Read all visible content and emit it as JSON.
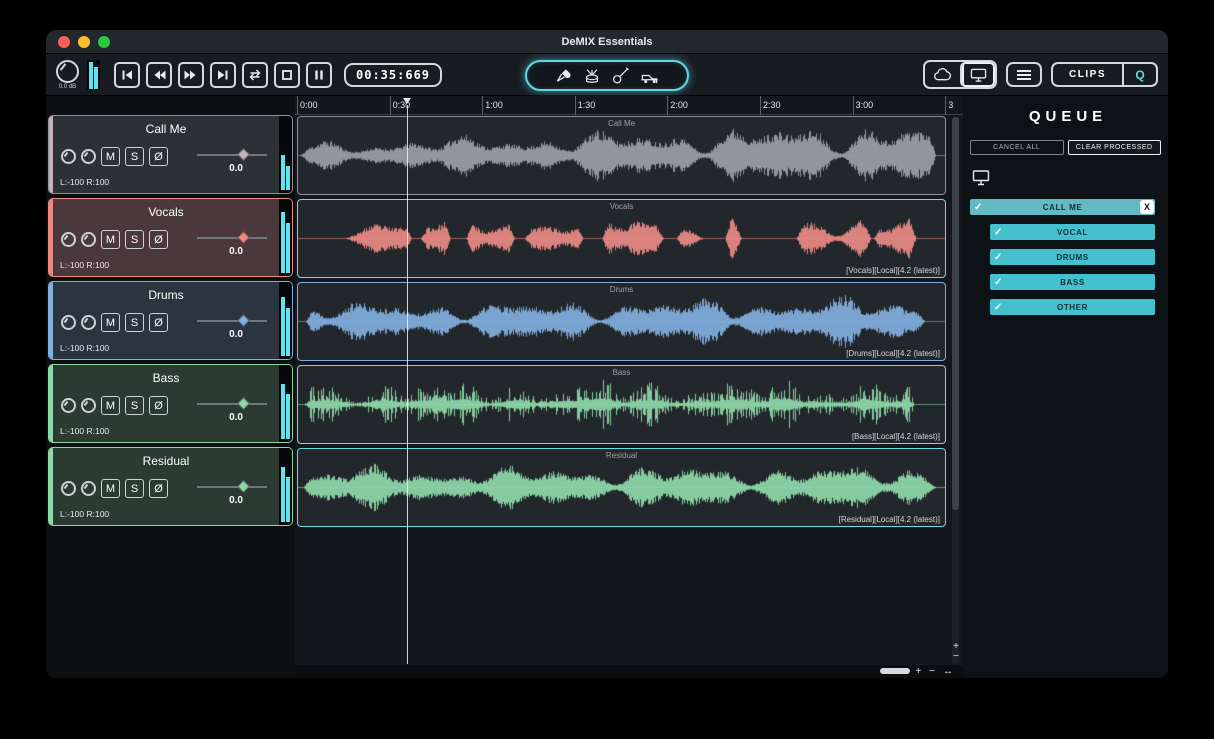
{
  "window": {
    "title": "DeMIX Essentials"
  },
  "toolbar": {
    "gain_label": "0.0 dB",
    "time_display": "00:35:669",
    "clips_label": "CLIPS",
    "queue_toggle_label": "Q"
  },
  "controls": {
    "mute": "M",
    "solo": "S",
    "phase": "Ø"
  },
  "timeline": {
    "ticks": [
      "0:00",
      "0:30",
      "1:00",
      "1:30",
      "2:00",
      "2:30",
      "3:00",
      "3"
    ]
  },
  "vzoom": {
    "zoom_in": "+",
    "zoom_out": "−"
  },
  "hscroll": {
    "zoom_in": "+",
    "zoom_out": "−",
    "fit": "↔"
  },
  "tracks": [
    {
      "name": "Call Me",
      "volume": "0.0",
      "pan": "L:-100 R:100",
      "color": "#c4b2b8",
      "header_bg": "#2c3136",
      "border": "#8b9196",
      "meters": [
        0.5,
        0.34
      ]
    },
    {
      "name": "Vocals",
      "volume": "0.0",
      "pan": "L:-100 R:100",
      "color": "#e98a84",
      "header_bg": "#4a383c",
      "border": "#e98a84",
      "meters": [
        0.88,
        0.72
      ]
    },
    {
      "name": "Drums",
      "volume": "0.0",
      "pan": "L:-100 R:100",
      "color": "#82aede",
      "header_bg": "#2b3540",
      "border": "#82aede",
      "meters": [
        0.85,
        0.7
      ]
    },
    {
      "name": "Bass",
      "volume": "0.0",
      "pan": "L:-100 R:100",
      "color": "#8fd9a9",
      "header_bg": "#2b3a33",
      "border": "#8fd9a9",
      "meters": [
        0.8,
        0.66
      ]
    },
    {
      "name": "Residual",
      "volume": "0.0",
      "pan": "L:-100 R:100",
      "color": "#8fd9a9",
      "header_bg": "#2b3a33",
      "border": "#8fd9a9",
      "meters": [
        0.8,
        0.66
      ]
    }
  ],
  "lanes": [
    {
      "label": "Call Me",
      "tag": "",
      "color": "#9aa0a3",
      "border": "#8b9196",
      "wave": {
        "seed": 11,
        "amp": 0.82,
        "ramp": [
          0.42,
          1.12
        ],
        "segments": [
          [
            0.004,
            0.985
          ]
        ]
      }
    },
    {
      "label": "Vocals",
      "tag": "[Vocals][Local][4.2 (latest)]",
      "color": "#e98a84",
      "border": "#6adbe6",
      "wave": {
        "seed": 23,
        "amp": 0.6,
        "ramp": [
          1,
          1
        ],
        "segments": [
          [
            0.075,
            0.175
          ],
          [
            0.19,
            0.235
          ],
          [
            0.26,
            0.335
          ],
          [
            0.35,
            0.44
          ],
          [
            0.47,
            0.565
          ],
          [
            0.585,
            0.625
          ],
          [
            0.66,
            0.685
          ],
          [
            0.77,
            0.885
          ],
          [
            0.89,
            0.955
          ]
        ]
      }
    },
    {
      "label": "Drums",
      "tag": "[Drums][Local][4.2 (latest)]",
      "color": "#82aede",
      "border": "#82aede",
      "wave": {
        "seed": 37,
        "amp": 0.62,
        "ramp": [
          0.75,
          1.05
        ],
        "segments": [
          [
            0.012,
            0.968
          ]
        ]
      }
    },
    {
      "label": "Bass",
      "tag": "[Bass][Local][4.2 (latest)]",
      "color": "#8fd9a9",
      "border": "#8fd9a9",
      "wave": {
        "seed": 51,
        "amp": 0.42,
        "spiky": true,
        "ramp": [
          1,
          1
        ],
        "segments": [
          [
            0.01,
            0.952
          ]
        ]
      }
    },
    {
      "label": "Residual",
      "tag": "[Residual][Local][4.2 (latest)]",
      "color": "#8fd9a9",
      "border": "#6adbe6",
      "wave": {
        "seed": 67,
        "amp": 0.55,
        "ramp": [
          0.95,
          1.05
        ],
        "segments": [
          [
            0.008,
            0.985
          ]
        ]
      }
    }
  ],
  "queue": {
    "title": "QUEUE",
    "cancel_all_label": "CANCEL ALL",
    "clear_processed_label": "CLEAR PROCESSED",
    "check_glyph": "✓",
    "close_label": "X",
    "items": [
      {
        "label": "CALL ME",
        "checked": true,
        "closable": true,
        "child": false
      },
      {
        "label": "VOCAL",
        "checked": true,
        "child": true
      },
      {
        "label": "DRUMS",
        "checked": true,
        "child": true
      },
      {
        "label": "BASS",
        "checked": true,
        "child": true
      },
      {
        "label": "OTHER",
        "checked": true,
        "child": true
      }
    ]
  },
  "colors": {
    "accent": "#5fd7e4",
    "meter": "#5fe4ef",
    "waveform_gray": "#9aa0a3",
    "waveform_salmon": "#e98a84",
    "waveform_blue": "#82aede",
    "waveform_green": "#8fd9a9"
  }
}
